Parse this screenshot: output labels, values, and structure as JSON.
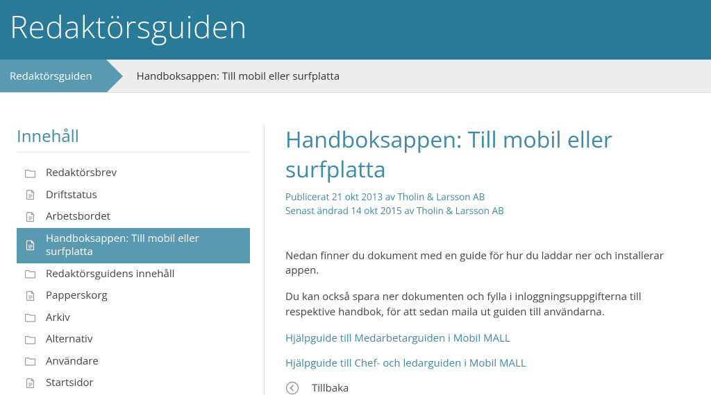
{
  "header": {
    "title": "Redaktörsguiden"
  },
  "breadcrumb": {
    "root": "Redaktörsguiden",
    "current": "Handboksappen: Till mobil eller surfplatta"
  },
  "sidebar": {
    "title": "Innehåll",
    "items": [
      {
        "icon": "folder",
        "label": "Redaktörsbrev",
        "active": false
      },
      {
        "icon": "doc",
        "label": "Driftstatus",
        "active": false
      },
      {
        "icon": "doc",
        "label": "Arbetsbordet",
        "active": false
      },
      {
        "icon": "doc",
        "label": "Handboksappen: Till mobil eller surfplatta",
        "active": true
      },
      {
        "icon": "folder",
        "label": "Redaktörsguidens innehåll",
        "active": false
      },
      {
        "icon": "doc",
        "label": "Papperskorg",
        "active": false
      },
      {
        "icon": "folder",
        "label": "Arkiv",
        "active": false
      },
      {
        "icon": "folder",
        "label": "Alternativ",
        "active": false
      },
      {
        "icon": "folder",
        "label": "Användare",
        "active": false
      },
      {
        "icon": "doc",
        "label": "Startsidor",
        "active": false
      }
    ]
  },
  "article": {
    "title": "Handboksappen: Till mobil eller surfplatta",
    "published_label": "Publicerat 21 okt 2013 av Tholin & Larsson AB",
    "modified_label": "Senast ändrad 14 okt 2015 av Tholin & Larsson AB",
    "para1": "Nedan finner du dokument med en guide för hur du laddar ner och installerar appen.",
    "para2": "Du kan också spara ner dokumenten och fylla i inloggningsuppgifterna till respektive handbok, för att sedan maila ut guiden till användarna.",
    "link1": "Hjälpguide till Medarbetarguiden i Mobil MALL",
    "link2": "Hjälpguide till Chef- och ledarguiden i Mobil MALL",
    "back_label": "Tillbaka"
  },
  "colors": {
    "brand_dark": "#297a98",
    "brand": "#3f8aa6",
    "brand_light": "#5a9ab1",
    "bg_bar": "#ededed"
  }
}
